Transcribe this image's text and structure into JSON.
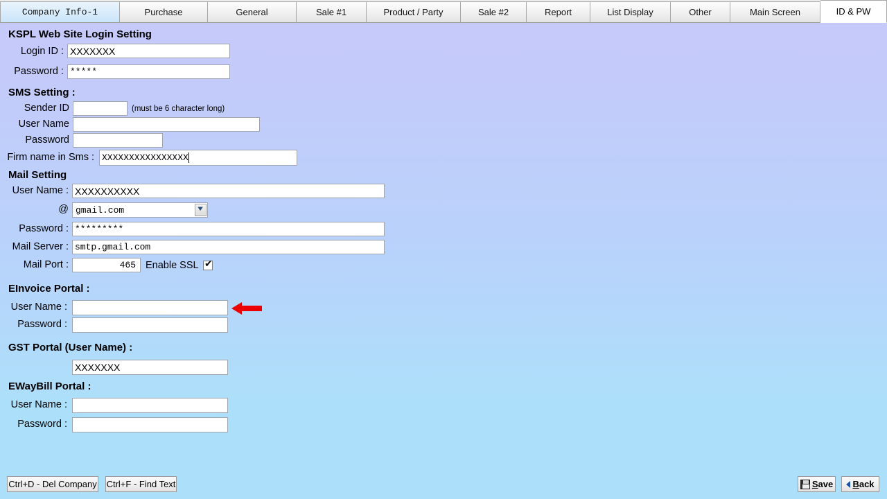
{
  "tabs": [
    {
      "label": "Company Info-1",
      "state": "hover"
    },
    {
      "label": "Purchase",
      "state": "normal"
    },
    {
      "label": "General",
      "state": "normal"
    },
    {
      "label": "Sale #1",
      "state": "normal"
    },
    {
      "label": "Product / Party",
      "state": "normal"
    },
    {
      "label": "Sale #2",
      "state": "normal"
    },
    {
      "label": "Report",
      "state": "normal"
    },
    {
      "label": "List Display",
      "state": "normal"
    },
    {
      "label": "Other",
      "state": "normal"
    },
    {
      "label": "Main Screen",
      "state": "normal"
    },
    {
      "label": "ID & PW",
      "state": "active"
    }
  ],
  "sections": {
    "website": {
      "title": "KSPL Web Site Login Setting",
      "login_id_label": "Login ID :",
      "login_id_value": "XXXXXXX",
      "password_label": "Password :",
      "password_value": "*****"
    },
    "sms": {
      "title": "SMS Setting :",
      "sender_id_label": "Sender ID",
      "sender_id_value": "",
      "sender_id_hint": "(must be 6 character long)",
      "user_name_label": "User Name",
      "user_name_value": "",
      "password_label": "Password",
      "password_value": "",
      "firm_name_label": "Firm name in Sms  :",
      "firm_name_value": "XXXXXXXXXXXXXXXX"
    },
    "mail": {
      "title": "Mail Setting",
      "user_name_label": "User Name :",
      "user_name_value": "XXXXXXXXXX",
      "at_label": "@",
      "domain_value": "gmail.com",
      "password_label": "Password :",
      "password_value": "*********",
      "mail_server_label": "Mail Server :",
      "mail_server_value": "smtp.gmail.com",
      "mail_port_label": "Mail Port :",
      "mail_port_value": "465",
      "enable_ssl_label": "Enable SSL",
      "enable_ssl_checked": "✔"
    },
    "einvoice": {
      "title": "EInvoice Portal :",
      "user_name_label": "User Name :",
      "user_name_value": "",
      "password_label": "Password :",
      "password_value": ""
    },
    "gst": {
      "title": "GST Portal (User Name) :",
      "user_name_value": "XXXXXXX"
    },
    "ewaybill": {
      "title": "EWayBill Portal :",
      "user_name_label": "User Name :",
      "user_name_value": "",
      "password_label": "Password :",
      "password_value": ""
    }
  },
  "bottom_bar": {
    "del_company_label": "Ctrl+D - Del Company",
    "find_text_label": "Ctrl+F - Find Text",
    "save_label_first": "S",
    "save_label_rest": "ave",
    "back_label_first": "B",
    "back_label_rest": "ack"
  },
  "annotation": {
    "arrow_color": "#ec0000",
    "arrow_direction": "left",
    "points_at": "einvoice-user-name-field"
  },
  "colors": {
    "background_top": "#c7c9fa",
    "background_bottom": "#ace0fa",
    "field_background": "#ffffff",
    "field_border": "#9fa4ad",
    "text": "#000000"
  }
}
